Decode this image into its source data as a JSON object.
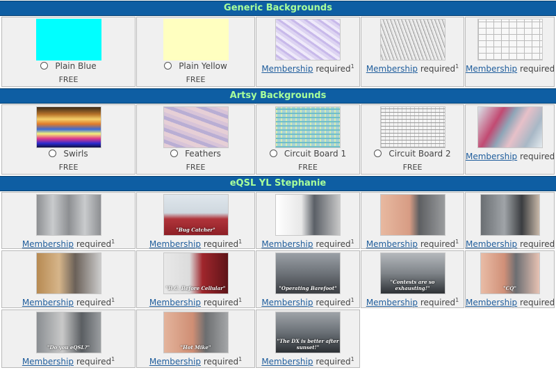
{
  "sections": [
    {
      "title": "Generic Backgrounds"
    },
    {
      "title": "Artsy Backgrounds"
    },
    {
      "title": "eQSL YL Stephanie"
    }
  ],
  "membership_link": "Membership",
  "required_text": "required",
  "footnote_mark": "1",
  "free_label": "FREE",
  "generic": [
    {
      "name": "Plain Blue",
      "price": "FREE",
      "color": "#00ffff"
    },
    {
      "name": "Plain Yellow",
      "price": "FREE",
      "color": "#ffffc0"
    }
  ],
  "artsy": [
    {
      "name": "Swirls",
      "price": "FREE"
    },
    {
      "name": "Feathers",
      "price": "FREE"
    },
    {
      "name": "Circuit Board 1",
      "price": "FREE"
    },
    {
      "name": "Circuit Board 2",
      "price": "FREE"
    }
  ],
  "photo_captions": {
    "bug": "\"Bug Catcher\"",
    "cellular": "\"B.C. Before Cellular\"",
    "barefoot": "\"Operating Barefoot\"",
    "contests": "\"Contests are so exhausting!\"",
    "cq": "\"CQ\"",
    "doyou": "\"Do you eQSL?\"",
    "hotmike": "\"Hot Mike\"",
    "dx": "\"The DX is better after sunset!\""
  },
  "colors": {
    "header_bg": "#0e5ea3",
    "header_text": "#a8ff9a",
    "cell_bg": "#f0f0f0",
    "link": "#1f5d9c"
  }
}
